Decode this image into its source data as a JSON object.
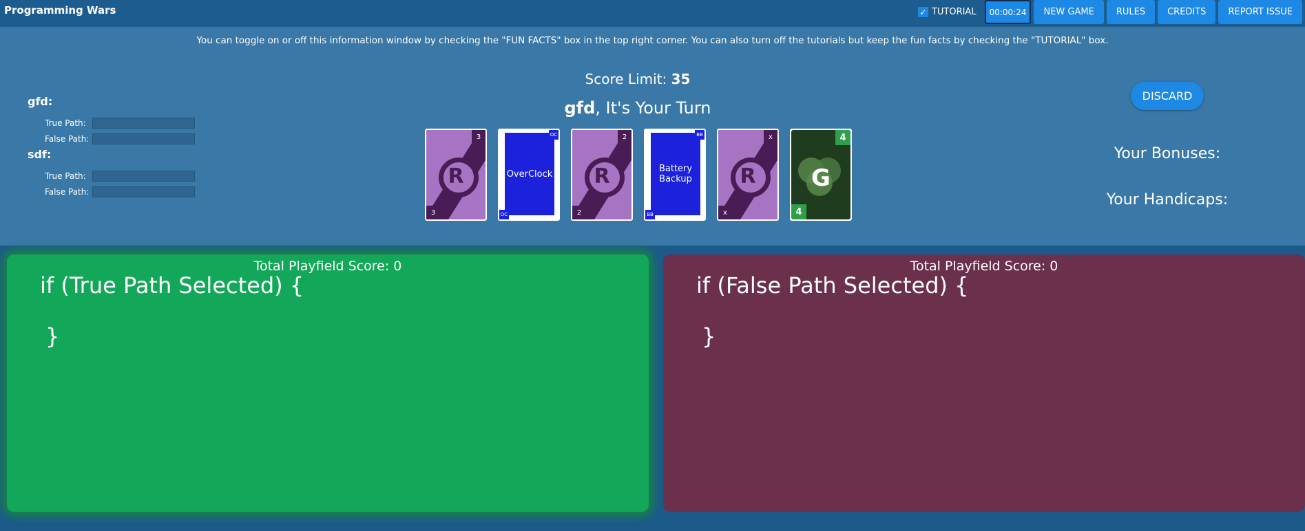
{
  "header": {
    "title": "Programming Wars",
    "tutorial_label": "TUTORIAL",
    "tutorial_checked": true,
    "timer": "00:00:24",
    "buttons": {
      "new_game": "NEW GAME",
      "rules": "RULES",
      "credits": "CREDITS",
      "report_issue": "REPORT ISSUE"
    }
  },
  "info_text": "You can toggle on or off this information window by checking the \"FUN FACTS\" box in the top right corner. You can also turn off the tutorials but keep the fun facts by checking the \"TUTORIAL\" box.",
  "players": [
    {
      "name": "gfd:",
      "true_label": "True Path:",
      "false_label": "False Path:"
    },
    {
      "name": "sdf:",
      "true_label": "True Path:",
      "false_label": "False Path:"
    }
  ],
  "score_limit": {
    "label": "Score Limit: ",
    "value": "35"
  },
  "turn": {
    "player": "gfd",
    "suffix": ", It's Your Turn"
  },
  "hand": [
    {
      "type": "reverse",
      "letter": "R",
      "value": "3"
    },
    {
      "type": "blue",
      "text": "OverClock",
      "tag": "OC"
    },
    {
      "type": "reverse",
      "letter": "R",
      "value": "2"
    },
    {
      "type": "blue",
      "text": "Battery Backup",
      "tag": "BB"
    },
    {
      "type": "reverse",
      "letter": "R",
      "value": "x"
    },
    {
      "type": "green",
      "letter": "G",
      "value": "4"
    }
  ],
  "discard_label": "DISCARD",
  "bonuses_label": "Your Bonuses:",
  "handicaps_label": "Your Handicaps:",
  "fields": {
    "true": {
      "score_label": "Total Playfield Score: 0",
      "code_open": "if (True Path Selected) {",
      "code_close": "}"
    },
    "false": {
      "score_label": "Total Playfield Score: 0",
      "code_open": "if (False Path Selected) {",
      "code_close": "}"
    }
  },
  "colors": {
    "background": "#3a78a8",
    "header": "#1d5c8f",
    "button": "#1e88e5",
    "true_field": "#13a859",
    "false_field": "#6b304c",
    "reverse_card": "#a774c3",
    "blue_card": "#1c21dc",
    "green_card": "#1f3d1e"
  }
}
